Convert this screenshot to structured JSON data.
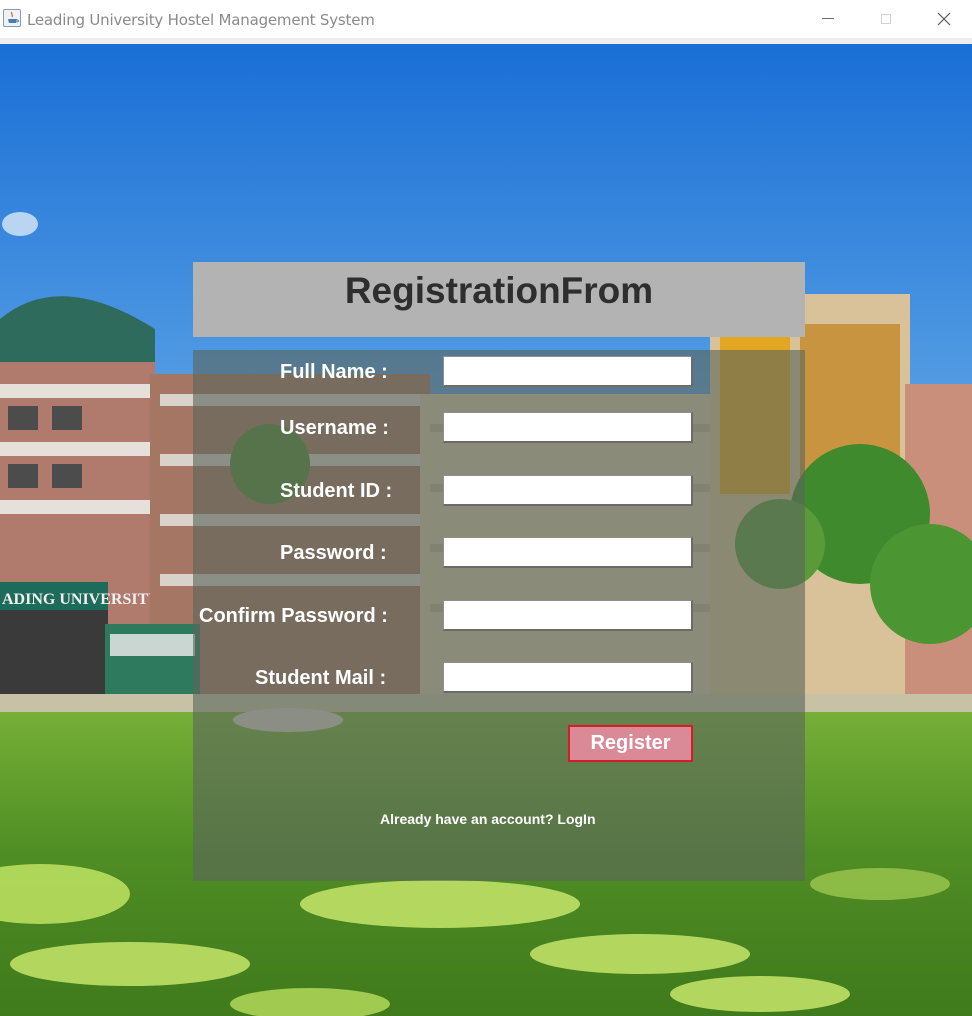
{
  "window": {
    "title": "Leading University Hostel Management System",
    "app_icon": "java-cup-icon",
    "controls": [
      "minimize-icon",
      "maximize-icon",
      "close-icon"
    ]
  },
  "background": {
    "sign_text": "ADING UNIVERSITY"
  },
  "form": {
    "heading": "RegistrationFrom",
    "fields": [
      {
        "label": "Full Name  :",
        "value": ""
      },
      {
        "label": "Username :",
        "value": ""
      },
      {
        "label": "Student ID :",
        "value": ""
      },
      {
        "label": "Password :",
        "value": ""
      },
      {
        "label": "Confirm Password :",
        "value": ""
      },
      {
        "label": "Student Mail :",
        "value": ""
      }
    ],
    "register_label": "Register",
    "login_prompt": "Already have an account? LogIn"
  },
  "colors": {
    "header_bg": "#b3b3b3",
    "register_bg": "#d98a96",
    "register_border": "#d41c2c"
  }
}
